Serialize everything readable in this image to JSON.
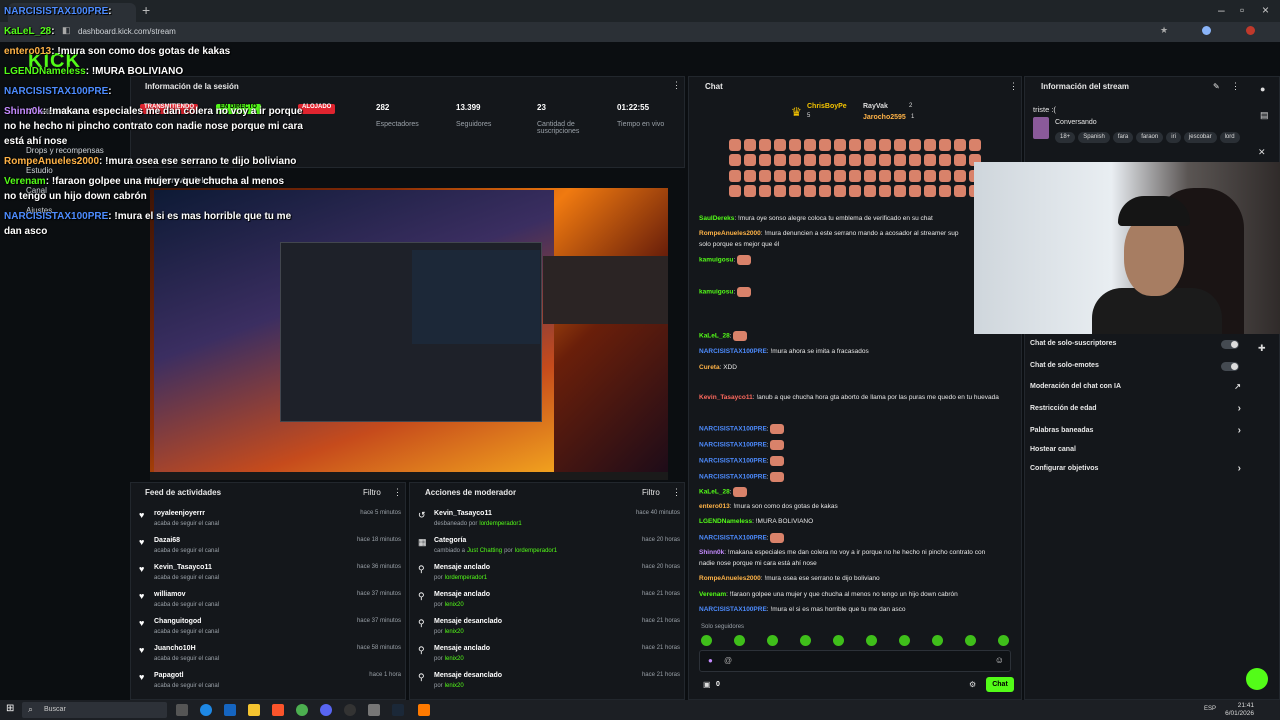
{
  "browser": {
    "url": "dashboard.kick.com/stream",
    "clock_time": "21:41",
    "clock_date": "6/01/2026",
    "lang": "ESP",
    "taskbar_search": "Buscar"
  },
  "logo": "KICK",
  "leftnav": {
    "items": [
      "Monetización",
      "Drops y recompensas",
      "Estudio",
      "Canal",
      "Ajustes"
    ]
  },
  "session": {
    "title": "Información de la sesión",
    "badges": [
      "TRANSMITIENDO",
      "EN DIRECTO",
      "ALOJADO"
    ],
    "stats": [
      {
        "value": "282",
        "label": "Espectadores"
      },
      {
        "value": "13.399",
        "label": "Seguidores"
      },
      {
        "value": "23",
        "label": "Cantidad de suscripciones"
      },
      {
        "value": "01:22:55",
        "label": "Tiempo en vivo"
      }
    ]
  },
  "preview": {
    "title": "Vista previa del stream"
  },
  "feed": {
    "title": "Feed de actividades",
    "filter": "Filtro",
    "rows": [
      {
        "name": "royaleenjoyerrr",
        "sub": "acaba de seguir el canal",
        "time": "hace 5 minutos"
      },
      {
        "name": "Dazai68",
        "sub": "acaba de seguir el canal",
        "time": "hace 18 minutos"
      },
      {
        "name": "Kevin_Tasayco11",
        "sub": "acaba de seguir el canal",
        "time": "hace 36 minutos"
      },
      {
        "name": "williamov",
        "sub": "acaba de seguir el canal",
        "time": "hace 37 minutos"
      },
      {
        "name": "Changuitogod",
        "sub": "acaba de seguir el canal",
        "time": "hace 37 minutos"
      },
      {
        "name": "Juancho10H",
        "sub": "acaba de seguir el canal",
        "time": "hace 58 minutos"
      },
      {
        "name": "Papagotl",
        "sub": "acaba de seguir el canal",
        "time": "hace 1 hora"
      }
    ]
  },
  "modactions": {
    "title": "Acciones de moderador",
    "filter": "Filtro",
    "rows": [
      {
        "name": "Kevin_Tasayco11",
        "sub": "desbaneado por",
        "by": "lordemperador1",
        "time": "hace 40 minutos"
      },
      {
        "name": "Categoría",
        "sub": "cambiado a",
        "by": "Just Chatting",
        "sub2": "por",
        "by2": "lordemperador1",
        "time": "hace 20 horas"
      },
      {
        "name": "Mensaje anclado",
        "sub": "por",
        "by": "lordemperador1",
        "time": "hace 20 horas"
      },
      {
        "name": "Mensaje anclado",
        "sub": "por",
        "by": "lenix20",
        "time": "hace 21 horas"
      },
      {
        "name": "Mensaje desanclado",
        "sub": "por",
        "by": "lenix20",
        "time": "hace 21 horas"
      },
      {
        "name": "Mensaje anclado",
        "sub": "por",
        "by": "lenix20",
        "time": "hace 21 horas"
      },
      {
        "name": "Mensaje desanclado",
        "sub": "por",
        "by": "lenix20",
        "time": "hace 21 horas"
      }
    ]
  },
  "chat": {
    "title": "Chat",
    "top_gifters": [
      {
        "name": "ChrisBoyPe",
        "count": "5"
      },
      {
        "name": "RayVak",
        "count": "2"
      },
      {
        "name": "Jarocho2595",
        "count": "1"
      }
    ],
    "messages": [
      {
        "user": "SaulDereks",
        "color": "#53fc18",
        "text": "!mura oye sonso alegre coloca tu emblema de verificado en su chat"
      },
      {
        "user": "RompeAnueles2000",
        "color": "#ffb347",
        "text": "!mura denuncien a este serrano mando a acosador al streamer sup"
      },
      {
        "user": "",
        "color": "#e8e8e8",
        "text": "solo porque es mejor que él"
      },
      {
        "user": "kamuigosu",
        "color": "#53fc18",
        "text": ""
      },
      {
        "user": "kamuigosu",
        "color": "#53fc18",
        "text": ""
      },
      {
        "user": "KaLeL_28",
        "color": "#53fc18",
        "text": ""
      },
      {
        "user": "NARCISISTAX100PRE",
        "color": "#4d8cff",
        "text": "!mura ahora se imita a fracasados"
      },
      {
        "user": "Cureta",
        "color": "#ffb347",
        "text": "XDD"
      },
      {
        "user": "Kevin_Tasayco11",
        "color": "#ff6a5e",
        "text": "!anub a que chucha hora gta aborto de llama por las puras me quedo en tu huevada"
      },
      {
        "user": "NARCISISTAX100PRE",
        "color": "#4d8cff",
        "text": ""
      },
      {
        "user": "NARCISISTAX100PRE",
        "color": "#4d8cff",
        "text": ""
      },
      {
        "user": "NARCISISTAX100PRE",
        "color": "#4d8cff",
        "text": ""
      },
      {
        "user": "NARCISISTAX100PRE",
        "color": "#4d8cff",
        "text": ""
      },
      {
        "user": "KaLeL_28",
        "color": "#53fc18",
        "text": ""
      },
      {
        "user": "entero013",
        "color": "#ffb347",
        "text": "!mura son como dos gotas de kakas"
      },
      {
        "user": "LGENDNameless",
        "color": "#53fc18",
        "text": "!MURA BOLIVIANO"
      },
      {
        "user": "NARCISISTAX100PRE",
        "color": "#4d8cff",
        "text": ""
      },
      {
        "user": "Shinn0k",
        "color": "#c58bff",
        "text": "!makana especiales me dan colera no voy a ir porque no he hecho ni pincho contrato con"
      },
      {
        "user": "",
        "color": "#e8e8e8",
        "text": "nadie nose porque mi cara está ahí nose"
      },
      {
        "user": "RompeAnueles2000",
        "color": "#ffb347",
        "text": "!mura osea ese serrano te dijo boliviano"
      },
      {
        "user": "Verenam",
        "color": "#53fc18",
        "text": "!faraon golpee una mujer y que chucha al menos no tengo un hijo down cabrón"
      },
      {
        "user": "NARCISISTAX100PRE",
        "color": "#4d8cff",
        "text": "!mura el si es mas horrible que tu me dan asco"
      }
    ],
    "followers_only": "Solo seguidores",
    "input_placeholder": "",
    "send_label": "Chat",
    "points": "0"
  },
  "streaminfo": {
    "title": "Información del stream",
    "stream_title": "triste :(",
    "category": "Conversando",
    "tags": [
      "18+",
      "Spanish",
      "fara",
      "faraon",
      "iri",
      "jescobar",
      "lord"
    ],
    "settings": [
      {
        "label": "Chat de solo-suscriptores",
        "kind": "toggle"
      },
      {
        "label": "Chat de solo-emotes",
        "kind": "toggle"
      },
      {
        "label": "Moderación del chat con IA",
        "kind": "link"
      },
      {
        "label": "Restricción de edad",
        "kind": "chevron"
      },
      {
        "label": "Palabras baneadas",
        "kind": "chevron"
      },
      {
        "label": "Hostear canal",
        "kind": "none"
      },
      {
        "label": "Configurar objetivos",
        "kind": "chevron"
      }
    ]
  },
  "overlay": [
    {
      "user": "NARCISISTAX100PRE",
      "color": "#4d8cff",
      "text": ""
    },
    {
      "user": "KaLeL_28",
      "color": "#53fc18",
      "text": ""
    },
    {
      "user": "entero013",
      "color": "#ffb347",
      "text": "!mura son como dos gotas de kakas"
    },
    {
      "user": "LGENDNameless",
      "color": "#53fc18",
      "text": "!MURA BOLIVIANO"
    },
    {
      "user": "NARCISISTAX100PRE",
      "color": "#4d8cff",
      "text": ""
    },
    {
      "user": "Shinn0k",
      "color": "#c58bff",
      "text": "!makana especiales me dan colera no voy a ir porque"
    },
    {
      "user": "",
      "color": "#fff",
      "text": "no he hecho ni pincho contrato con nadie nose porque mi cara"
    },
    {
      "user": "",
      "color": "#fff",
      "text": "está ahí nose"
    },
    {
      "user": "RompeAnueles2000",
      "color": "#ffb347",
      "text": "!mura osea ese serrano te dijo boliviano"
    },
    {
      "user": "Verenam",
      "color": "#53fc18",
      "text": "!faraon golpee una mujer y que chucha al menos"
    },
    {
      "user": "",
      "color": "#fff",
      "text": "no tengo un hijo down cabrón"
    },
    {
      "user": "NARCISISTAX100PRE",
      "color": "#4d8cff",
      "text": "!mura el si es mas horrible que tu me"
    },
    {
      "user": "",
      "color": "#fff",
      "text": "dan asco"
    }
  ]
}
